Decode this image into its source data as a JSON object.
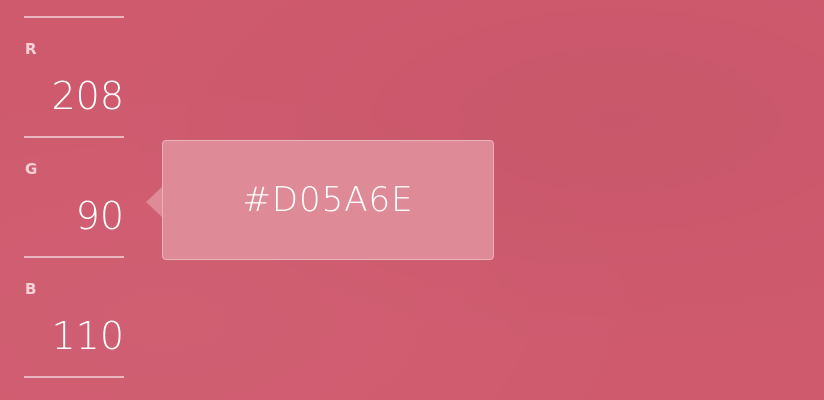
{
  "channels": {
    "r": {
      "label": "R",
      "value": "208"
    },
    "g": {
      "label": "G",
      "value": "90"
    },
    "b": {
      "label": "B",
      "value": "110"
    }
  },
  "hex_display": "#D05A6E",
  "colors": {
    "background": "#cf5a6e",
    "tooltip": "#de8a97"
  }
}
